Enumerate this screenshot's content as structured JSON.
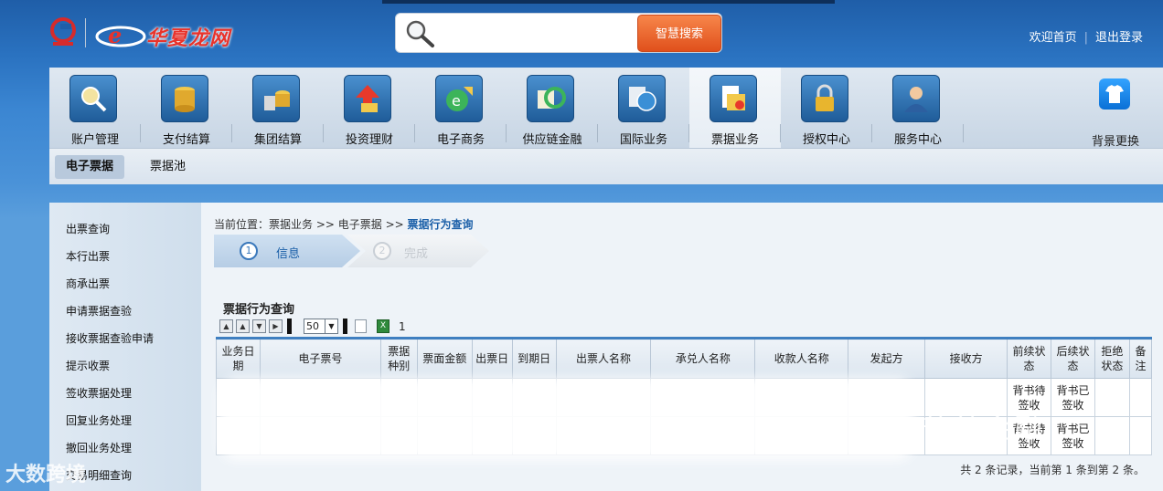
{
  "header": {
    "logo_text": "华夏龙网",
    "search_placeholder": "",
    "search_button": "智慧搜索",
    "link_home": "欢迎首页",
    "link_logout": "退出登录",
    "link_sep": "|"
  },
  "nav": {
    "items": [
      {
        "label": "账户管理",
        "icon": "magnifier-coins-icon"
      },
      {
        "label": "支付结算",
        "icon": "coin-stack-icon"
      },
      {
        "label": "集团结算",
        "icon": "group-coins-icon"
      },
      {
        "label": "投资理财",
        "icon": "growth-arrow-icon"
      },
      {
        "label": "电子商务",
        "icon": "ecommerce-globe-icon"
      },
      {
        "label": "供应链金融",
        "icon": "chain-cycle-icon"
      },
      {
        "label": "国际业务",
        "icon": "globe-icon"
      },
      {
        "label": "票据业务",
        "icon": "bill-document-icon"
      },
      {
        "label": "授权中心",
        "icon": "padlock-icon"
      },
      {
        "label": "服务中心",
        "icon": "service-person-icon"
      }
    ],
    "active_index": 7,
    "skin_label": "背景更换"
  },
  "subtabs": [
    {
      "label": "电子票据",
      "active": true
    },
    {
      "label": "票据池",
      "active": false
    }
  ],
  "sidebar": {
    "items": [
      "出票查询",
      "本行出票",
      "商承出票",
      "申请票据查验",
      "接收票据查验申请",
      "提示收票",
      "签收票据处理",
      "回复业务处理",
      "撤回业务处理",
      "交易明细查询"
    ]
  },
  "breadcrumb": {
    "prefix": "当前位置：",
    "path": "票据业务 >> 电子票据 >>",
    "current": "票据行为查询"
  },
  "steps": [
    {
      "num": "1",
      "label": "信息",
      "active": true
    },
    {
      "num": "2",
      "label": "完成",
      "active": false
    }
  ],
  "query": {
    "title": "票据行为查询",
    "page_size": "50",
    "page_count": "1"
  },
  "table": {
    "headers": [
      "业务日期",
      "电子票号",
      "票据种别",
      "票面金额",
      "出票日",
      "到期日",
      "出票人名称",
      "承兑人名称",
      "收款人名称",
      "发起方",
      "接收方",
      "前续状态",
      "后续状态",
      "拒绝状态",
      "备注"
    ],
    "rows": [
      [
        "",
        "",
        "",
        "",
        "",
        "",
        "",
        "",
        "",
        "",
        "",
        "背书待签收",
        "背书已签收",
        "",
        ""
      ],
      [
        "",
        "",
        "",
        "",
        "",
        "",
        "",
        "",
        "",
        "",
        "",
        "背书待签收",
        "背书已签收",
        "",
        ""
      ]
    ]
  },
  "footer": {
    "summary": "共 2 条记录，当前第 1 条到第 2 条。"
  },
  "watermarks": {
    "right": "普益金融",
    "left": "大数跨境"
  },
  "colors": {
    "accent": "#3f7fc0",
    "search_button": "#e8602a",
    "brand_red": "#e8332b"
  }
}
